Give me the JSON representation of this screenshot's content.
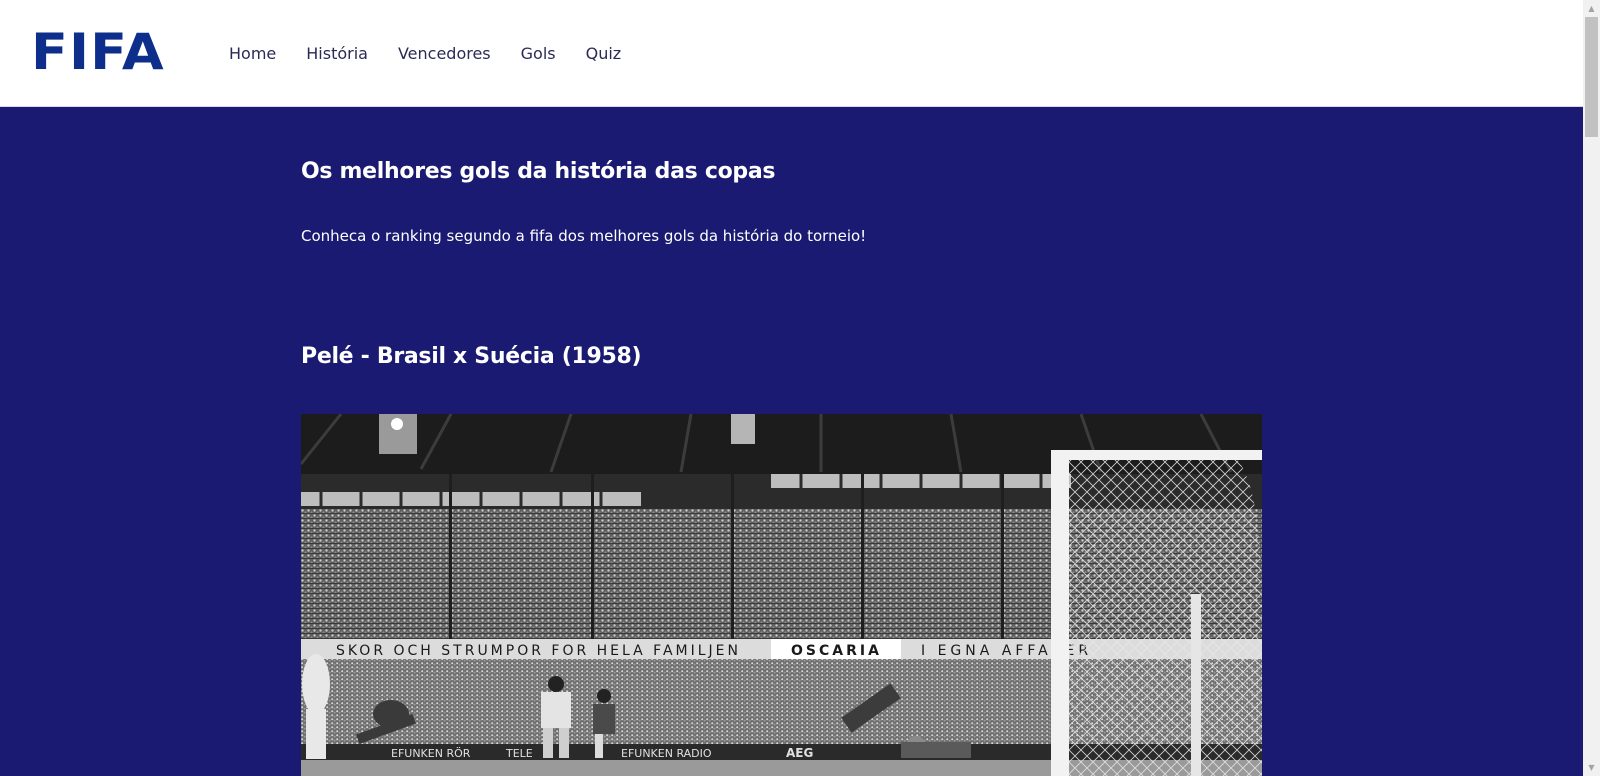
{
  "header": {
    "logo_text": "FIFA",
    "nav": [
      {
        "label": "Home"
      },
      {
        "label": "História"
      },
      {
        "label": "Vencedores"
      },
      {
        "label": "Gols"
      },
      {
        "label": "Quiz"
      }
    ]
  },
  "main": {
    "title": "Os melhores gols da história das copas",
    "intro": "Conheca o ranking segundo a fifa dos melhores gols da história do torneio!",
    "goals": [
      {
        "title": "Pelé - Brasil x Suécia (1958)",
        "photo": {
          "banner_left": "SKOR OCH STRUMPOR FOR HELA FAMILJEN",
          "banner_brand": "OSCARIA",
          "banner_right": "I EGNA AFFARER",
          "board_1": "EFUNKEN RÖR",
          "board_2": "TELE",
          "board_3": "EFUNKEN RADIO",
          "board_4": "AEG"
        }
      }
    ]
  },
  "colors": {
    "background": "#1a1a72",
    "header_bg": "#ffffff",
    "logo": "#0d2e8a",
    "nav_text": "#2a2a55",
    "text": "#ffffff"
  },
  "icons": {
    "scroll_up": "scroll-up-arrow-icon",
    "scroll_down": "scroll-down-arrow-icon"
  }
}
